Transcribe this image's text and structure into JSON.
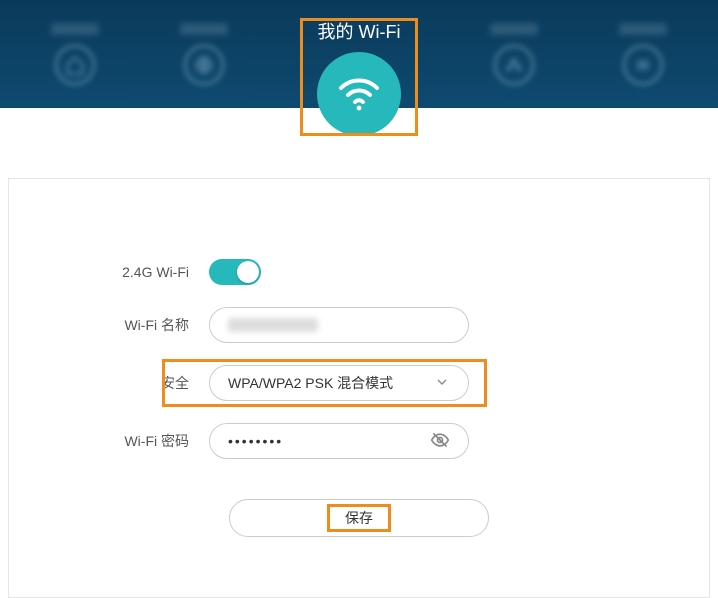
{
  "header": {
    "title": "我的 Wi-Fi"
  },
  "form": {
    "band_label": "2.4G Wi-Fi",
    "band_enabled": true,
    "name_label": "Wi-Fi 名称",
    "name_value": "",
    "security_label": "安全",
    "security_value": "WPA/WPA2 PSK 混合模式",
    "password_label": "Wi-Fi 密码",
    "password_value": "••••••••",
    "save_label": "保存"
  }
}
